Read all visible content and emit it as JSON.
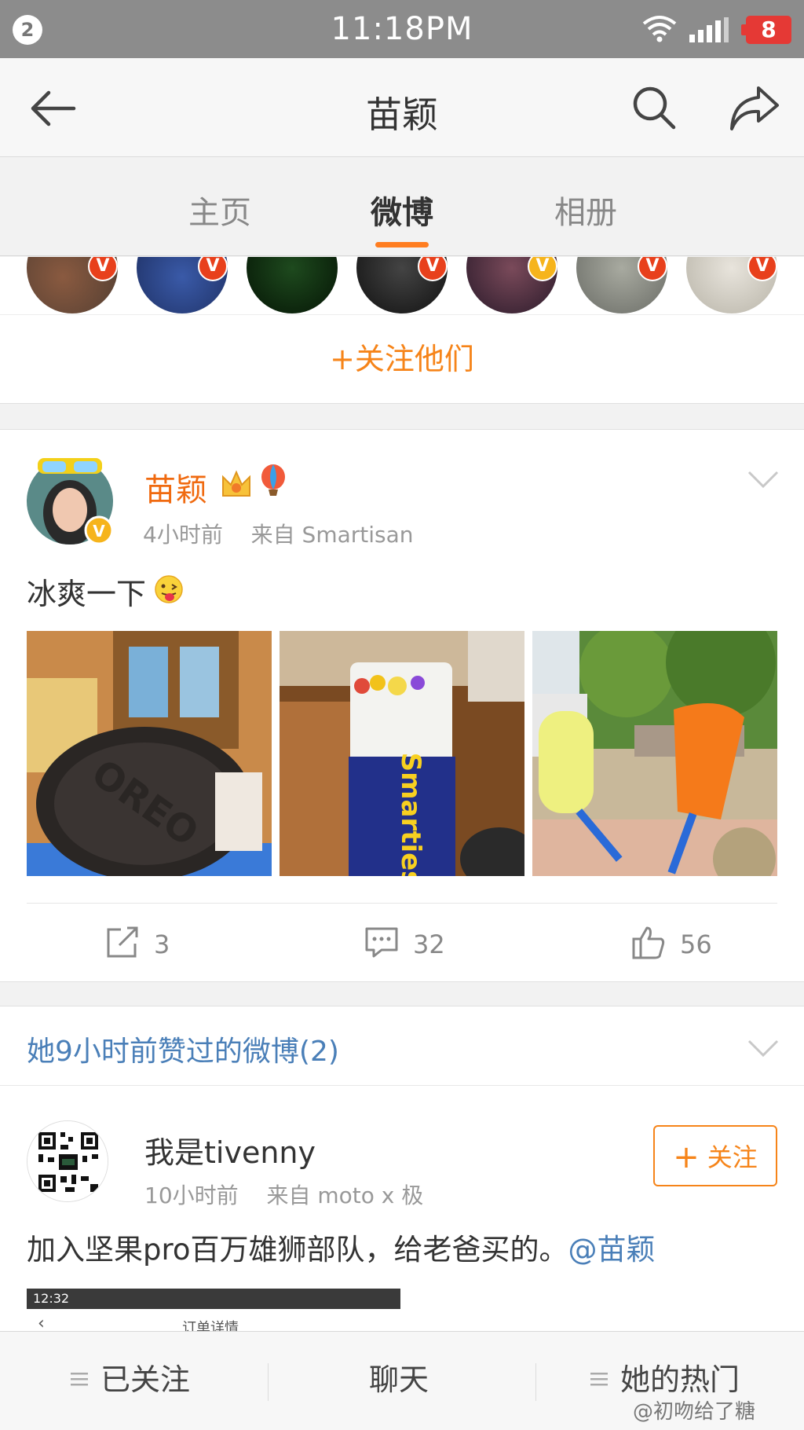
{
  "status_bar": {
    "notification_count": "2",
    "time": "11:18PM",
    "battery": "8"
  },
  "header": {
    "title": "苗颖"
  },
  "tabs": [
    {
      "label": "主页"
    },
    {
      "label": "微博"
    },
    {
      "label": "相册"
    }
  ],
  "follow_them_label": "+关注他们",
  "post": {
    "author": "苗颖",
    "time": "4小时前",
    "source": "来自 Smartisan",
    "text": "冰爽一下",
    "reposts": "3",
    "comments": "32",
    "likes": "56"
  },
  "liked_section": {
    "title": "她9小时前赞过的微博(2)"
  },
  "post2": {
    "author": "我是tivenny",
    "time": "10小时前",
    "source": "来自 moto x 极",
    "follow_label": "关注",
    "text": "加入坚果pro百万雄狮部队，给老爸买的。",
    "mention": "@苗颖",
    "screenshot_time": "12:32",
    "screenshot_title": "订单详情"
  },
  "bottom_bar": {
    "followed": "已关注",
    "chat": "聊天",
    "hot": "她的热门"
  },
  "watermark": "@初吻给了糖",
  "colors": {
    "accent": "#f68419",
    "link": "#4a7fb8",
    "verified_red": "#e8401c",
    "verified_yellow": "#f6b41c"
  }
}
